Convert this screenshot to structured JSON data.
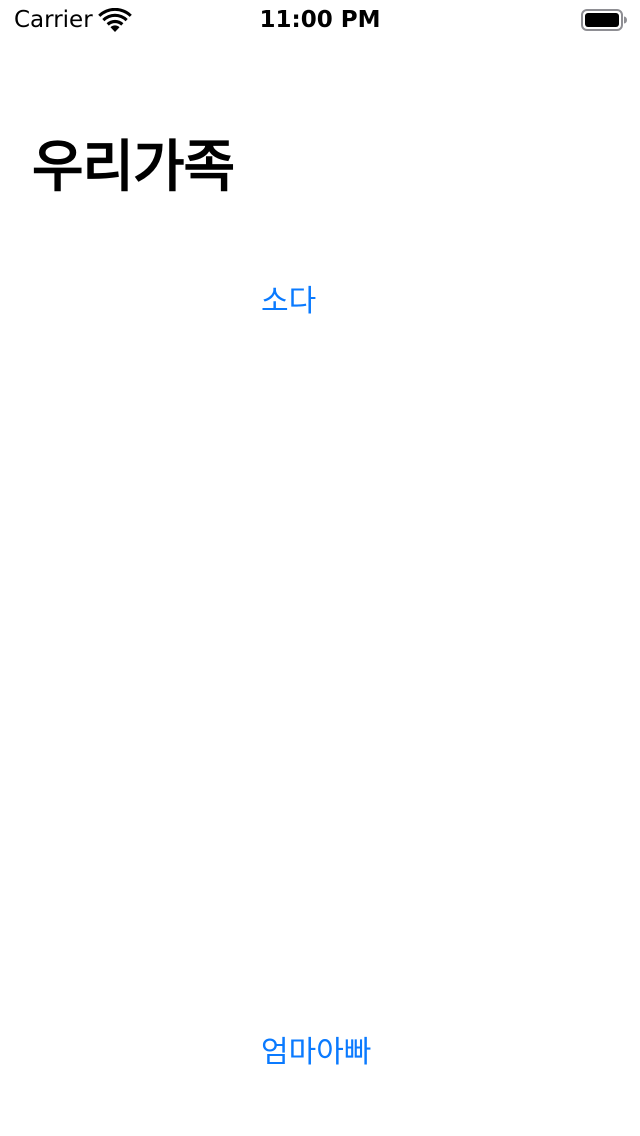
{
  "status_bar": {
    "carrier": "Carrier",
    "time": "11:00 PM",
    "wifi_icon": "wifi-icon",
    "battery_icon": "battery-full-icon"
  },
  "main": {
    "title": "우리가족",
    "buttons": [
      {
        "label": "소다"
      },
      {
        "label": "엄마아빠"
      }
    ]
  },
  "colors": {
    "accent": "#0a7aff",
    "text": "#000000",
    "background": "#ffffff"
  }
}
